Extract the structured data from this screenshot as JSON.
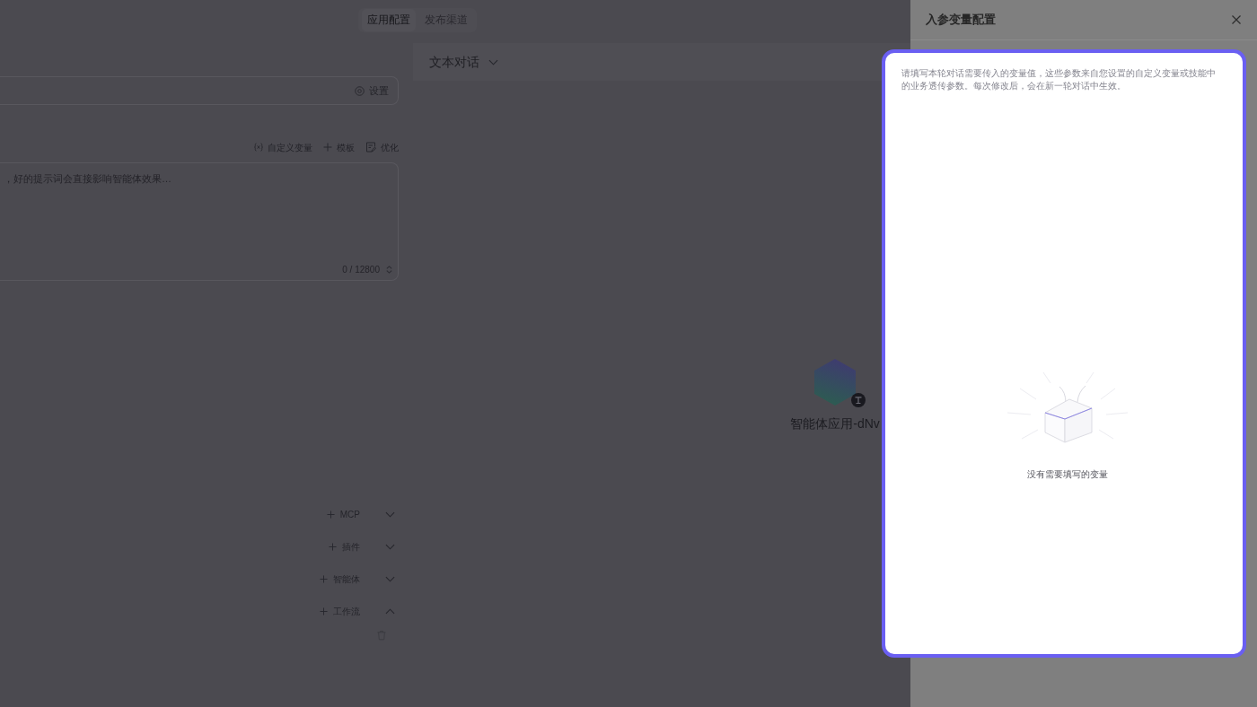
{
  "header_tabs": [
    {
      "label": "应用配置",
      "selected": true
    },
    {
      "label": "发布渠道",
      "selected": false
    }
  ],
  "config": {
    "settings_button": "设置",
    "prompt_toolbar": [
      {
        "kind": "variable",
        "label": "自定义变量"
      },
      {
        "kind": "template",
        "label": "模板"
      },
      {
        "kind": "optimize",
        "label": "优化"
      }
    ],
    "prompt": {
      "placeholder": "，好的提示词会直接影响智能体效果…",
      "counter": "0 / 12800"
    },
    "sections": [
      {
        "label": "MCP",
        "expanded": false
      },
      {
        "label": "插件",
        "expanded": false
      },
      {
        "label": "智能体",
        "expanded": false
      },
      {
        "label": "工作流",
        "expanded": true
      }
    ]
  },
  "preview": {
    "mode": "文本对话",
    "app_name": "智能体应用-dNv"
  },
  "drawer": {
    "title": "入参变量配置",
    "description": "请填写本轮对话需要传入的变量值，这些参数来自您设置的自定义变量或技能中的业务透传参数。每次修改后，会在新一轮对话中生效。",
    "empty_text": "没有需要填写的变量"
  }
}
